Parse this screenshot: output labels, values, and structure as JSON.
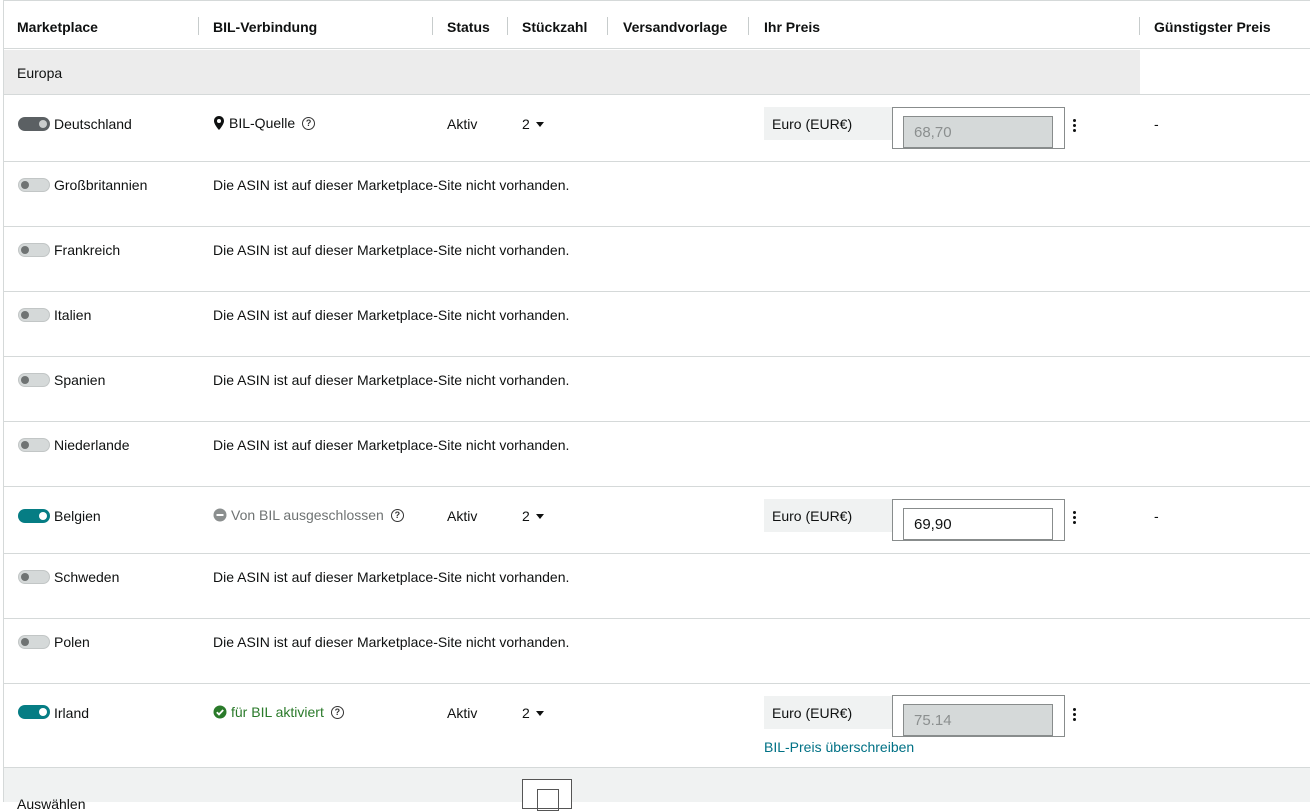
{
  "header": {
    "marketplace": "Marketplace",
    "bil_connection": "BIL-Verbindung",
    "status": "Status",
    "quantity": "Stückzahl",
    "shipping_template": "Versandvorlage",
    "your_price": "Ihr Preis",
    "lowest_price": "Günstigster Preis"
  },
  "group": {
    "label": "Europa"
  },
  "not_available_text": "Die ASIN ist auf dieser Marketplace-Site nicht vorhanden.",
  "rows": {
    "de": {
      "name": "Deutschland",
      "bil": "BIL-Quelle",
      "status": "Aktiv",
      "qty": "2",
      "currency": "Euro (EUR€)",
      "price": "68,70",
      "lowest": "-"
    },
    "gb": {
      "name": "Großbritannien"
    },
    "fr": {
      "name": "Frankreich"
    },
    "it": {
      "name": "Italien"
    },
    "es": {
      "name": "Spanien"
    },
    "nl": {
      "name": "Niederlande"
    },
    "be": {
      "name": "Belgien",
      "bil": "Von BIL ausgeschlossen",
      "status": "Aktiv",
      "qty": "2",
      "currency": "Euro (EUR€)",
      "price": "69,90",
      "lowest": "-"
    },
    "se": {
      "name": "Schweden"
    },
    "pl": {
      "name": "Polen"
    },
    "ie": {
      "name": "Irland",
      "bil": "für BIL aktiviert",
      "status": "Aktiv",
      "qty": "2",
      "currency": "Euro (EUR€)",
      "price": "75.14",
      "override": "BIL-Preis überschreiben"
    }
  },
  "footer": {
    "label": "Auswählen"
  },
  "colors": {
    "accent": "#067d84",
    "link": "#007185",
    "success": "#2a7a2a"
  }
}
